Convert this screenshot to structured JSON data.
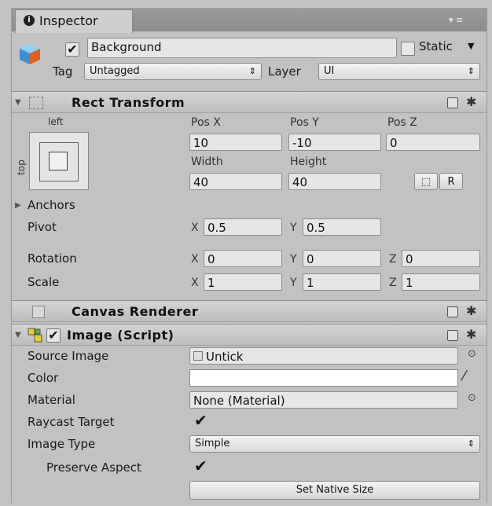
{
  "window": {
    "tab_label": "Inspector",
    "tab_glyph": "i",
    "controls": "▾ ≡"
  },
  "object": {
    "name": "Background",
    "active": true,
    "static_label": "Static",
    "static_checked": false,
    "tag_label": "Tag",
    "tag_value": "Untagged",
    "layer_label": "Layer",
    "layer_value": "UI"
  },
  "rect_transform": {
    "title": "Rect Transform",
    "anchor_left": "left",
    "anchor_top": "top",
    "pos_x_label": "Pos X",
    "pos_y_label": "Pos Y",
    "pos_z_label": "Pos Z",
    "pos_x": "10",
    "pos_y": "-10",
    "pos_z": "0",
    "width_label": "Width",
    "height_label": "Height",
    "width": "40",
    "height": "40",
    "r_button": "R",
    "anchors_label": "Anchors",
    "pivot_label": "Pivot",
    "pivot_x": "0.5",
    "pivot_y": "0.5",
    "rotation_label": "Rotation",
    "rot_x": "0",
    "rot_y": "0",
    "rot_z": "0",
    "scale_label": "Scale",
    "scale_x": "1",
    "scale_y": "1",
    "scale_z": "1",
    "x_letter": "X",
    "y_letter": "Y",
    "z_letter": "Z"
  },
  "canvas_renderer": {
    "title": "Canvas Renderer"
  },
  "image": {
    "title": "Image (Script)",
    "source_image_label": "Source Image",
    "source_image_value": "Untick",
    "color_label": "Color",
    "color_value": "#ffffff",
    "material_label": "Material",
    "material_value": "None (Material)",
    "raycast_label": "Raycast Target",
    "raycast_checked": true,
    "image_type_label": "Image Type",
    "image_type_value": "Simple",
    "preserve_label": "Preserve Aspect",
    "preserve_checked": true,
    "native_size_button": "Set Native Size"
  }
}
